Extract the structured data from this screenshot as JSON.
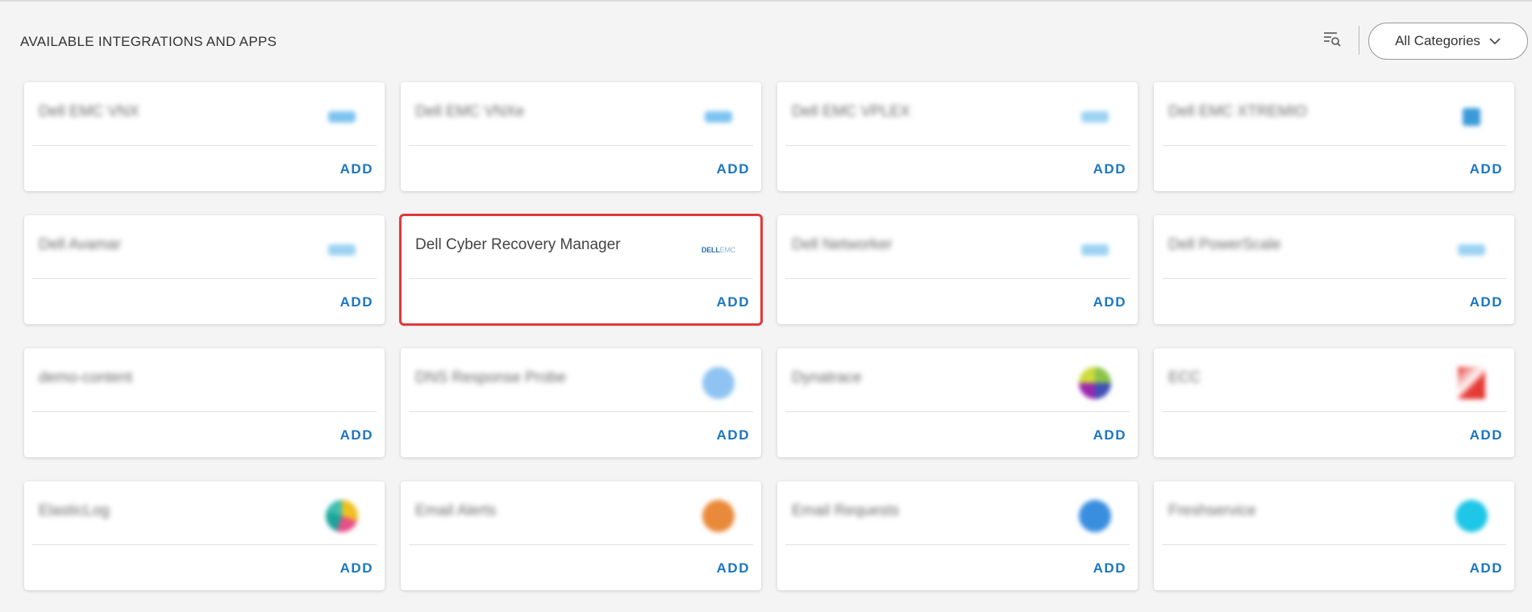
{
  "header": {
    "title": "AVAILABLE INTEGRATIONS AND APPS",
    "category_select": "All Categories"
  },
  "cards": [
    {
      "name": "Dell EMC VNX",
      "add_label": "ADD",
      "logo_color": "#7cc3f0",
      "logo_shape": "strip"
    },
    {
      "name": "Dell EMC VNXe",
      "add_label": "ADD",
      "logo_color": "#7cc3f0",
      "logo_shape": "strip"
    },
    {
      "name": "Dell EMC VPLEX",
      "add_label": "ADD",
      "logo_color": "#9cd2f2",
      "logo_shape": "strip"
    },
    {
      "name": "Dell EMC XTREMIO",
      "add_label": "ADD",
      "logo_color": "#3a9ad9",
      "logo_shape": "square-small"
    },
    {
      "name": "Dell Avamar",
      "add_label": "ADD",
      "logo_color": "#9cd2f2",
      "logo_shape": "strip"
    },
    {
      "name": "Dell Cyber Recovery Manager",
      "add_label": "ADD",
      "logo_color": "#2b6fb4",
      "logo_shape": "dell-text",
      "logo_text": "DELL",
      "logo_subtext": "EMC"
    },
    {
      "name": "Dell Networker",
      "add_label": "ADD",
      "logo_color": "#9cd2f2",
      "logo_shape": "strip"
    },
    {
      "name": "Dell PowerScale",
      "add_label": "ADD",
      "logo_color": "#9cd2f2",
      "logo_shape": "strip"
    },
    {
      "name": "demo-content",
      "add_label": "ADD",
      "logo_color": "",
      "logo_shape": "none"
    },
    {
      "name": "DNS Response Probe",
      "add_label": "ADD",
      "logo_color": "#8fc4f2",
      "logo_shape": "dot"
    },
    {
      "name": "Dynatrace",
      "add_label": "ADD",
      "logo_color": "#8bc34a",
      "logo_shape": "dot-multi"
    },
    {
      "name": "ECC",
      "add_label": "ADD",
      "logo_color": "#e53935",
      "logo_shape": "square"
    },
    {
      "name": "ElasticLog",
      "add_label": "ADD",
      "logo_color": "#f0c020",
      "logo_shape": "dot-elastic"
    },
    {
      "name": "Email Alerts",
      "add_label": "ADD",
      "logo_color": "#e98a3a",
      "logo_shape": "dot"
    },
    {
      "name": "Email Requests",
      "add_label": "ADD",
      "logo_color": "#3a8ee0",
      "logo_shape": "dot"
    },
    {
      "name": "Freshservice",
      "add_label": "ADD",
      "logo_color": "#1ec6e8",
      "logo_shape": "dot"
    }
  ],
  "selected_card": "Dell Cyber Recovery Manager"
}
